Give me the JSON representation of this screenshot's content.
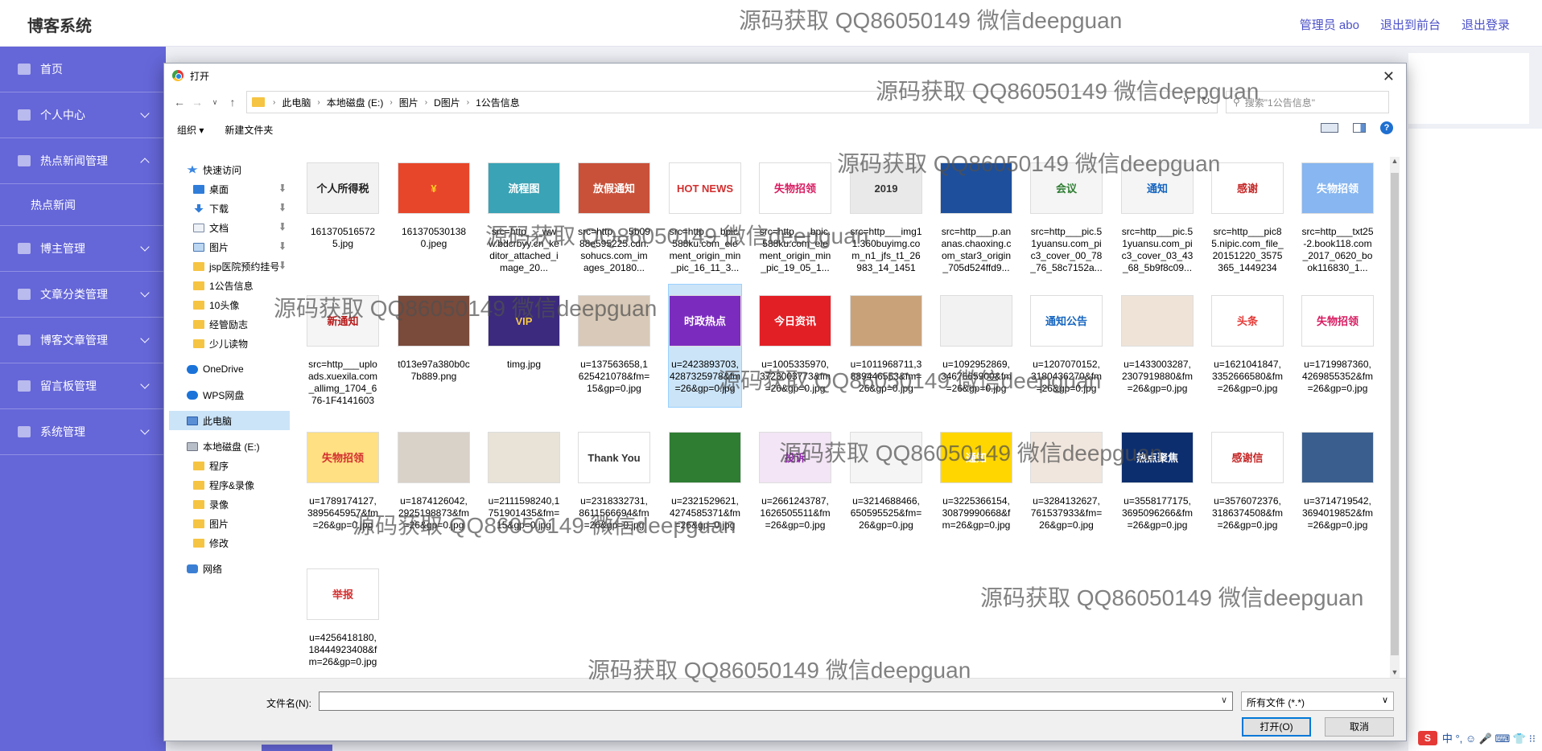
{
  "header": {
    "brand": "博客系统",
    "admin_link": "管理员 abo",
    "to_frontend": "退出到前台",
    "logout": "退出登录"
  },
  "sidebar": {
    "items": [
      {
        "label": "首页",
        "icon": "home-icon"
      },
      {
        "label": "个人中心",
        "icon": "user-icon",
        "chevron": "down"
      },
      {
        "label": "热点新闻管理",
        "icon": "clock-icon",
        "chevron": "up"
      },
      {
        "label": "热点新闻",
        "sub": true
      },
      {
        "label": "博主管理",
        "icon": "book-icon",
        "chevron": "down"
      },
      {
        "label": "文章分类管理",
        "icon": "folder-icon",
        "chevron": "down"
      },
      {
        "label": "博客文章管理",
        "icon": "send-icon",
        "chevron": "down"
      },
      {
        "label": "留言板管理",
        "icon": "message-icon",
        "chevron": "down"
      },
      {
        "label": "系统管理",
        "icon": "list-icon",
        "chevron": "down"
      }
    ]
  },
  "dialog": {
    "title": "打开",
    "breadcrumbs": [
      "此电脑",
      "本地磁盘 (E:)",
      "图片",
      "D图片",
      "1公告信息"
    ],
    "search_placeholder": "搜索\"1公告信息\"",
    "organize": "组织 ▾",
    "new_folder": "新建文件夹",
    "tree": [
      {
        "label": "快速访问",
        "icon": "star",
        "lvl": 1
      },
      {
        "label": "桌面",
        "icon": "blue",
        "lvl": 2,
        "pin": true
      },
      {
        "label": "下载",
        "icon": "down",
        "lvl": 2,
        "pin": true
      },
      {
        "label": "文档",
        "icon": "doc",
        "lvl": 2,
        "pin": true
      },
      {
        "label": "图片",
        "icon": "img",
        "lvl": 2,
        "pin": true
      },
      {
        "label": "jsp医院预约挂号",
        "icon": "fold",
        "lvl": 2,
        "pin": true
      },
      {
        "label": "1公告信息",
        "icon": "fold",
        "lvl": 2
      },
      {
        "label": "10头像",
        "icon": "fold",
        "lvl": 2
      },
      {
        "label": "经管励志",
        "icon": "fold",
        "lvl": 2
      },
      {
        "label": "少儿读物",
        "icon": "fold",
        "lvl": 2
      },
      {
        "label": "",
        "icon": "",
        "lvl": 0
      },
      {
        "label": "OneDrive",
        "icon": "cloud",
        "lvl": 1
      },
      {
        "label": "",
        "icon": "",
        "lvl": 0
      },
      {
        "label": "WPS网盘",
        "icon": "cloud",
        "lvl": 1
      },
      {
        "label": "",
        "icon": "",
        "lvl": 0
      },
      {
        "label": "此电脑",
        "icon": "pc",
        "lvl": 1,
        "selected": true
      },
      {
        "label": "",
        "icon": "",
        "lvl": 0
      },
      {
        "label": "本地磁盘 (E:)",
        "icon": "drive",
        "lvl": 1
      },
      {
        "label": "程序",
        "icon": "fold",
        "lvl": 2
      },
      {
        "label": "程序&录像",
        "icon": "fold",
        "lvl": 2
      },
      {
        "label": "录像",
        "icon": "fold",
        "lvl": 2
      },
      {
        "label": "图片",
        "icon": "fold",
        "lvl": 2
      },
      {
        "label": "修改",
        "icon": "fold",
        "lvl": 2
      },
      {
        "label": "",
        "icon": "",
        "lvl": 0
      },
      {
        "label": "网络",
        "icon": "net",
        "lvl": 1
      }
    ],
    "files": [
      {
        "name": "1613705165725.jpg",
        "color": "#f2f2f2",
        "text": "个人所得税",
        "tc": "#222"
      },
      {
        "name": "1613705301380.jpeg",
        "color": "#e8462a",
        "text": "¥",
        "tc": "#ffd21f"
      },
      {
        "name": "src=http___www.bdcrbyy.cn_keditor_attached_image_20...",
        "color": "#3aa3b5",
        "text": "流程图",
        "tc": "#fff"
      },
      {
        "name": "src=http___5b0988e595225.cdn.sohucs.com_images_20180...",
        "color": "#c9513a",
        "text": "放假通知",
        "tc": "#fff"
      },
      {
        "name": "src=http___bpic.588ku.com_element_origin_min_pic_16_11_3...",
        "color": "#ffffff",
        "text": "HOT NEWS",
        "tc": "#d32f2f"
      },
      {
        "name": "src=http___bpic.588ku.com_element_origin_min_pic_19_05_1...",
        "color": "#ffffff",
        "text": "失物招领",
        "tc": "#d81b60"
      },
      {
        "name": "src=http___img11.360buyimg.com_n1_jfs_t1_26983_14_14517...",
        "color": "#e9e9e9",
        "text": "2019",
        "tc": "#333"
      },
      {
        "name": "src=http___p.ananas.chaoxing.com_star3_origin_705d524ffd9...",
        "color": "#1d4f9c",
        "text": "",
        "tc": "#fff"
      },
      {
        "name": "src=http___pic.51yuansu.com_pic3_cover_00_78_76_58c7152a...",
        "color": "#f5f5f5",
        "text": "会议",
        "tc": "#2e7d32"
      },
      {
        "name": "src=http___pic.51yuansu.com_pic3_cover_03_43_68_5b9f8c09...",
        "color": "#f5f5f5",
        "text": "通知",
        "tc": "#1565c0"
      },
      {
        "name": "src=http___pic85.nipic.com_file_20151220_3575365_14492347...",
        "color": "#ffffff",
        "text": "感谢",
        "tc": "#c62828"
      },
      {
        "name": "src=http___txt25-2.book118.com_2017_0620_book116830_1...",
        "color": "#87b6f0",
        "text": "失物招领",
        "tc": "#fff"
      },
      {
        "name": "src=http___uploads.xuexila.com_allimg_1704_676-1F41416031...",
        "color": "#f5f5f5",
        "text": "新通知",
        "tc": "#b71c1c"
      },
      {
        "name": "t013e97a380b0c7b889.png",
        "color": "#7a4a3a",
        "text": "",
        "tc": "#fff"
      },
      {
        "name": "timg.jpg",
        "color": "#3b2a7d",
        "text": "VIP",
        "tc": "#f7c948"
      },
      {
        "name": "u=137563658,1625421078&fm=15&gp=0.jpg",
        "color": "#d8c9b8",
        "text": "",
        "tc": "#fff"
      },
      {
        "name": "u=2423893703,4287325978&fm=26&gp=0.jpg",
        "color": "#7b2cbf",
        "text": "时政热点",
        "tc": "#fff",
        "selected": true
      },
      {
        "name": "u=1005335970,3723003773&fm=26&gp=0.jpg",
        "color": "#e31f26",
        "text": "今日资讯",
        "tc": "#fff"
      },
      {
        "name": "u=1011968711,3889446553&fm=26&gp=0.jpg",
        "color": "#caa27a",
        "text": "",
        "tc": "#fff"
      },
      {
        "name": "u=1092952869,3467665900&fm=26&gp=0.jpg",
        "color": "#f2f2f2",
        "text": "",
        "tc": "#c62828"
      },
      {
        "name": "u=1207070152,3180436270&fm=26&gp=0.jpg",
        "color": "#ffffff",
        "text": "通知公告",
        "tc": "#1565c0"
      },
      {
        "name": "u=1433003287,2307919880&fm=26&gp=0.jpg",
        "color": "#efe3d8",
        "text": "",
        "tc": "#fff"
      },
      {
        "name": "u=1621041847,3352666580&fm=26&gp=0.jpg",
        "color": "#ffffff",
        "text": "头条",
        "tc": "#e53935"
      },
      {
        "name": "u=1719987360,4269855352&fm=26&gp=0.jpg",
        "color": "#ffffff",
        "text": "失物招领",
        "tc": "#d81b60"
      },
      {
        "name": "u=1789174127,3895645957&fm=26&gp=0.jpg",
        "color": "#ffe082",
        "text": "失物招领",
        "tc": "#d32f2f"
      },
      {
        "name": "u=1874126042,2925198873&fm=26&gp=0.jpg",
        "color": "#d9d2c9",
        "text": "",
        "tc": "#fff"
      },
      {
        "name": "u=2111598240,1751901435&fm=15&gp=0.jpg",
        "color": "#e8e2d7",
        "text": "",
        "tc": "#fff"
      },
      {
        "name": "u=2318332731,8611566694&fm=26&gp=0.jpg",
        "color": "#ffffff",
        "text": "Thank You",
        "tc": "#333"
      },
      {
        "name": "u=2321529621,4274585371&fm=26&gp=0.jpg",
        "color": "#2e7d32",
        "text": "",
        "tc": "#fff"
      },
      {
        "name": "u=2661243787,1626505511&fm=26&gp=0.jpg",
        "color": "#f3e5f5",
        "text": "投诉",
        "tc": "#8e24aa"
      },
      {
        "name": "u=3214688466,650595525&fm=26&gp=0.jpg",
        "color": "#f5f5f5",
        "text": "",
        "tc": "#c62828"
      },
      {
        "name": "u=3225366154,30879990668&fm=26&gp=0.jpg",
        "color": "#ffd600",
        "text": "通知",
        "tc": "#fff"
      },
      {
        "name": "u=3284132627,761537933&fm=26&gp=0.jpg",
        "color": "#f0e6dd",
        "text": "",
        "tc": "#fff"
      },
      {
        "name": "u=3558177175,3695096266&fm=26&gp=0.jpg",
        "color": "#0d2e6e",
        "text": "热点聚焦",
        "tc": "#fff"
      },
      {
        "name": "u=3576072376,3186374508&fm=26&gp=0.jpg",
        "color": "#ffffff",
        "text": "感谢信",
        "tc": "#c62828"
      },
      {
        "name": "u=3714719542,3694019852&fm=26&gp=0.jpg",
        "color": "#3a5f8f",
        "text": "",
        "tc": "#fff"
      },
      {
        "name": "u=4256418180,18444923408&fm=26&gp=0.jpg",
        "color": "#ffffff",
        "text": "举报",
        "tc": "#d32f2f"
      }
    ],
    "filename_label": "文件名(N):",
    "filename_value": "",
    "filter": "所有文件 (*.*)",
    "open_btn": "打开(O)",
    "cancel_btn": "取消"
  },
  "tray": {
    "logo": "S",
    "ime": "中 °, ☺ 🎤 ⌨ 👕 ⁝⁝"
  },
  "watermark": "源码获取 QQ86050149 微信deepguan"
}
